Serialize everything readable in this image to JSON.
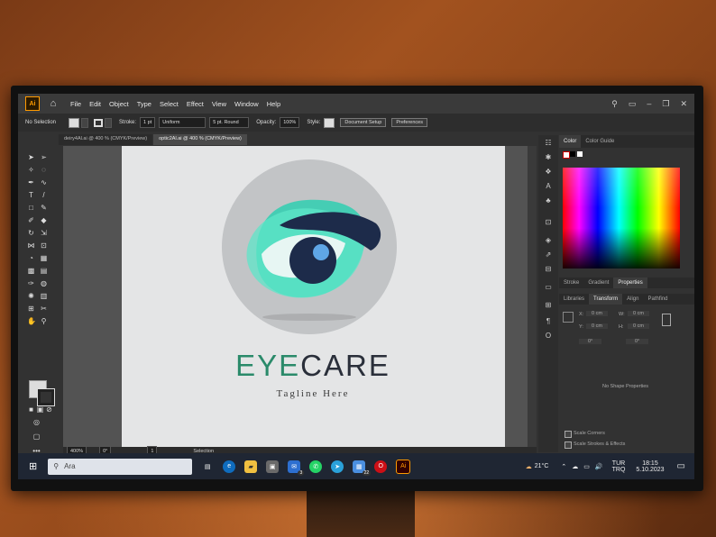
{
  "app": {
    "logo_text": "Ai"
  },
  "menu": [
    "File",
    "Edit",
    "Object",
    "Type",
    "Select",
    "Effect",
    "View",
    "Window",
    "Help"
  ],
  "control_bar": {
    "selection": "No Selection",
    "stroke_label": "Stroke:",
    "stroke_value": "1 pt",
    "profile": "Uniform",
    "brush": "5 pt. Round",
    "opacity_label": "Opacity:",
    "opacity_value": "100%",
    "style_label": "Style:",
    "doc_setup": "Document Setup",
    "preferences": "Preferences"
  },
  "tabs": [
    "deiry4Al.ai @ 400 % (CMYK/Preview)",
    "optic2Al.ai @ 400 % (CMYK/Preview)"
  ],
  "artwork": {
    "title_a": "EYE",
    "title_b": "CARE",
    "tagline": "Tagline Here",
    "title_a_color": "#2a8a6a",
    "title_b_color": "#2a2f3a"
  },
  "status": {
    "zoom": "400%",
    "rotation": "0°",
    "page": "1",
    "mode": "Selection"
  },
  "color_panel": {
    "tabs": [
      "Color",
      "Color Guide"
    ],
    "tabs2": [
      "Stroke",
      "Gradient",
      "Properties"
    ],
    "tabs3": [
      "Libraries",
      "Transform",
      "Align",
      "Pathfind"
    ],
    "x": "X:",
    "y": "Y:",
    "w": "W:",
    "h": "H:",
    "x_val": "0 cm",
    "y_val": "0 cm",
    "w_val": "0 cm",
    "h_val": "0 cm",
    "angle": "0°",
    "shear": "0°",
    "no_shape": "No Shape Properties",
    "scale_corners": "Scale Corners",
    "scale_strokes": "Scale Strokes & Effects"
  },
  "taskbar": {
    "search_placeholder": "Ara",
    "mail_badge": "3",
    "files_badge": "22",
    "weather": "21°C",
    "lang1": "TUR",
    "lang2": "TRQ",
    "time": "18:15",
    "date": "5.10.2023"
  }
}
